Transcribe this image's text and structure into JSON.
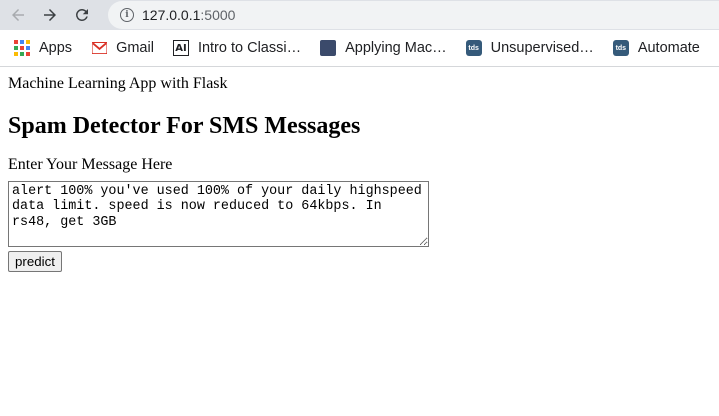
{
  "browser": {
    "url_host": "127.0.0.1",
    "url_port": ":5000",
    "bookmarks": [
      {
        "label": "Apps",
        "icon": "apps-grid-icon"
      },
      {
        "label": "Gmail",
        "icon": "gmail-icon"
      },
      {
        "label": "Intro to Classi…",
        "icon": "ai-icon"
      },
      {
        "label": "Applying Mac…",
        "icon": "article-icon"
      },
      {
        "label": "Unsupervised…",
        "icon": "tds-icon"
      },
      {
        "label": "Automate",
        "icon": "tds-icon"
      }
    ],
    "tds_text": "tds"
  },
  "page": {
    "app_title": "Machine Learning App with Flask",
    "heading": "Spam Detector For SMS Messages",
    "prompt": "Enter Your Message Here",
    "message": "alert 100% you've used 100% of your daily highspeed data limit. speed is now reduced to 64kbps. In rs48, get 3GB",
    "predict_label": "predict"
  },
  "colors": {
    "chrome_bg": "#dee1e6",
    "omnibox_bg": "#f1f3f4",
    "gmail_red": "#d93025"
  }
}
